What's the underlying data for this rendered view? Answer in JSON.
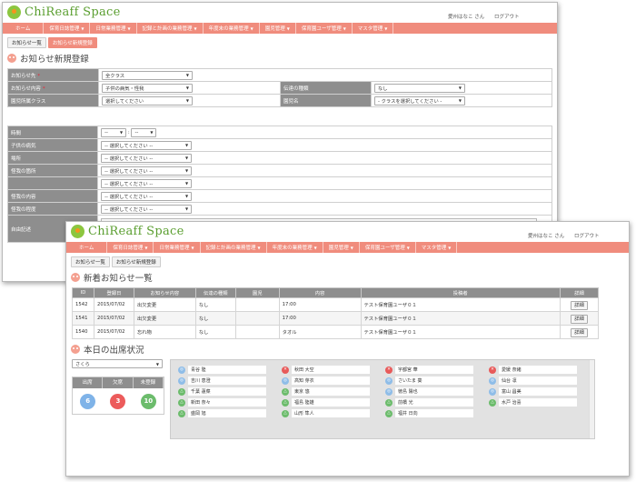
{
  "app": {
    "logo_text": "ChiReaff Space",
    "user_name": "愛州はなこ さん",
    "logout": "ログアウト",
    "nav": [
      "ホーム",
      "保育日誌管理",
      "日常業務管理",
      "記録と計画の業務管理",
      "年度末の業務管理",
      "園児管理",
      "保育園ユーザ管理",
      "マスタ管理"
    ],
    "accent_color": "#f08c7d"
  },
  "back": {
    "tabs": [
      "お知らせ一覧",
      "お知らせ新規登録"
    ],
    "section_title": "お知らせ新規登録",
    "form": {
      "dest_label": "お知らせ先",
      "dest_value": "全クラス",
      "content_label": "お知らせ内容",
      "content_value": "子供の病気・怪我",
      "class_label": "園児所属クラス",
      "class_value": "選択してください",
      "transmit_label": "伝達の種類",
      "transmit_value": "なし",
      "child_label": "園児名",
      "child_value": "- クラスを選択してください -",
      "time_label": "時間",
      "time_h": "--",
      "time_m": "--",
      "illness_label": "子供の病気",
      "place_label": "場所",
      "injury_place_label": "怪我の箇所",
      "injury_content_label": "怪我の内容",
      "injury_level_label": "怪我の程度",
      "free_label": "自由記述",
      "select_placeholder": "-- 選択してください --"
    }
  },
  "front": {
    "tabs": [
      "お知らせ一覧",
      "お知らせ新規登録"
    ],
    "news_title": "新着お知らせ一覧",
    "news_headers": [
      "ID",
      "登録日",
      "お知らせ内容",
      "伝達の種類",
      "園児",
      "内容",
      "投稿者",
      "詳細"
    ],
    "news_rows": [
      {
        "id": "1542",
        "date": "2015/07/02",
        "content": "出欠変更",
        "type": "なし",
        "child": "",
        "body": "17:00",
        "author": "テスト保育園ユーザ０１",
        "detail": "詳細"
      },
      {
        "id": "1541",
        "date": "2015/07/02",
        "content": "出欠変更",
        "type": "なし",
        "child": "",
        "body": "17:00",
        "author": "テスト保育園ユーザ０１",
        "detail": "詳細"
      },
      {
        "id": "1540",
        "date": "2015/07/02",
        "content": "忘れ物",
        "type": "なし",
        "child": "",
        "body": "タオル",
        "author": "テスト保育園ユーザ０１",
        "detail": "詳細"
      }
    ],
    "attendance_title": "本日の出席状況",
    "class_select": "さくら",
    "counts": {
      "present_label": "出席",
      "absent_label": "欠席",
      "unregistered_label": "未登録",
      "present": "6",
      "absent": "3",
      "unregistered": "10"
    },
    "children": [
      [
        {
          "name": "青谷 陸",
          "status": "blue"
        },
        {
          "name": "吉川 恵澄",
          "status": "blue"
        },
        {
          "name": "千葉 蓮菜",
          "status": "green"
        },
        {
          "name": "新田 奈々",
          "status": "green"
        },
        {
          "name": "盛岡 旭",
          "status": "green"
        }
      ],
      [
        {
          "name": "秋田 大空",
          "status": "red"
        },
        {
          "name": "高知 芽衣",
          "status": "blue"
        },
        {
          "name": "東京 悠",
          "status": "green"
        },
        {
          "name": "福島 陸雄",
          "status": "green"
        },
        {
          "name": "山形 隼人",
          "status": "green"
        }
      ],
      [
        {
          "name": "宇都宮 華",
          "status": "red"
        },
        {
          "name": "さいたま 葵",
          "status": "blue"
        },
        {
          "name": "徳島 陽也",
          "status": "blue"
        },
        {
          "name": "前橋 光",
          "status": "green"
        },
        {
          "name": "福井 日向",
          "status": "green"
        }
      ],
      [
        {
          "name": "愛媛 奈緒",
          "status": "red"
        },
        {
          "name": "仙台 凛",
          "status": "blue"
        },
        {
          "name": "富山 昌美",
          "status": "blue"
        },
        {
          "name": "水戸 治喜",
          "status": "green"
        }
      ]
    ],
    "status_colors": {
      "blue": "#8fbde8",
      "red": "#e85a5a",
      "green": "#6cbc6c"
    }
  }
}
